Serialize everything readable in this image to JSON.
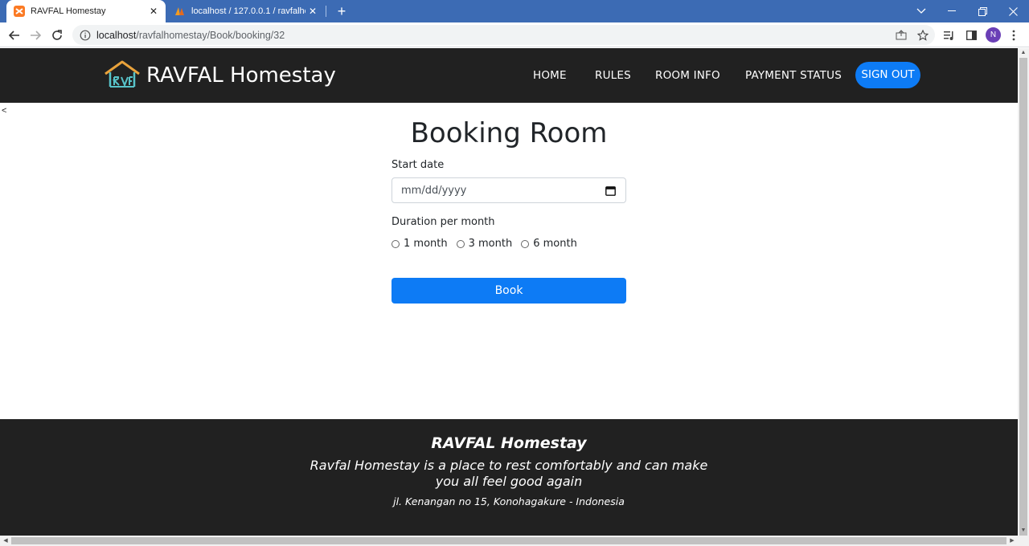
{
  "browser": {
    "tabs": [
      {
        "title": "RAVFAL Homestay",
        "active": true
      },
      {
        "title": "localhost / 127.0.0.1 / ravfalhome",
        "active": false
      }
    ],
    "url_host": "localhost",
    "url_path": "/ravfalhomestay/Book/booking/32",
    "profile_initial": "N"
  },
  "nav": {
    "brand": "RAVFAL Homestay",
    "links": [
      "HOME",
      "RULES",
      "ROOM INFO",
      "PAYMENT STATUS"
    ],
    "signout": "SIGN OUT"
  },
  "stray_char": "<",
  "form": {
    "title": "Booking Room",
    "start_date_label": "Start date",
    "start_date_placeholder": "mm/dd/yyyy",
    "duration_label": "Duration per month",
    "options": [
      "1 month",
      "3 month",
      "6 month"
    ],
    "submit": "Book"
  },
  "footer": {
    "title": "RAVFAL Homestay",
    "description": "Ravfal Homestay is a place to rest comfortably and can make you all feel good again",
    "address": "jl. Kenangan no 15, Konohagakure - Indonesia"
  },
  "colors": {
    "tabbar": "#3c6bb4",
    "nav_bg": "#212121",
    "primary": "#0d7bf5"
  }
}
